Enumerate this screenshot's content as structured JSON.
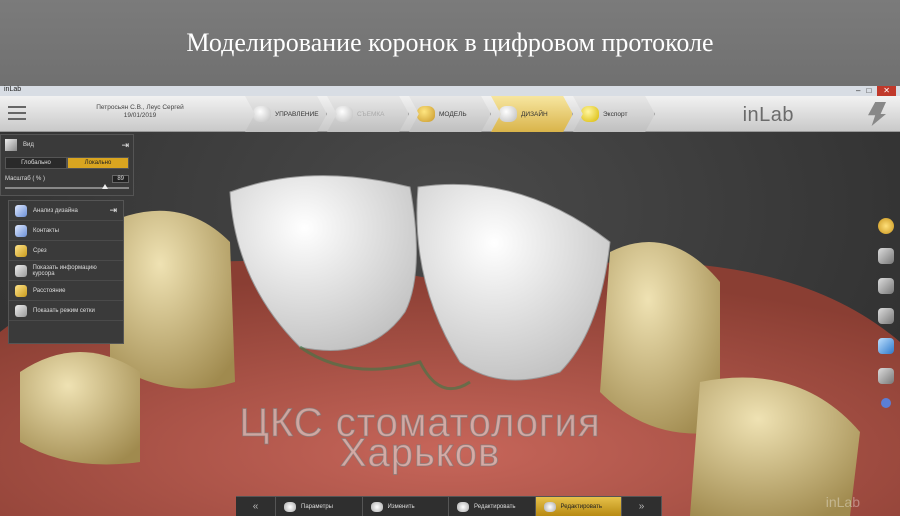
{
  "banner": {
    "title": "Моделирование коронок в цифровом протоколе"
  },
  "window": {
    "app_name": "inLab",
    "buttons": [
      "–",
      "□",
      "✕"
    ]
  },
  "toolbar": {
    "patient_name": "Петросьян С.В., Леус Сергей",
    "date": "19/01/2019",
    "steps": [
      {
        "label": "УПРАВЛЕНИЕ",
        "state": "done"
      },
      {
        "label": "СЪЕМКА",
        "state": "disabled"
      },
      {
        "label": "МОДЕЛЬ",
        "state": "done"
      },
      {
        "label": "ДИЗАЙН",
        "state": "active"
      },
      {
        "label": "Экспорт",
        "state": "next"
      }
    ],
    "brand": "inLab"
  },
  "view_panel": {
    "title": "Вид",
    "modes": [
      "Глобально",
      "Локально"
    ],
    "active_mode": "Локально",
    "scale_label": "Масштаб ( % )",
    "scale_value": "89"
  },
  "analysis_menu": {
    "title": "Анализ дизайна",
    "items": [
      "Контакты",
      "Срез",
      "Показать информацию курсора",
      "Расстояние",
      "Показать режим сетки"
    ]
  },
  "bottom_bar": {
    "items": [
      "Параметры",
      "Изменить",
      "Редактировать",
      "Редактировать"
    ],
    "active_index": 3
  },
  "watermark": {
    "line1": "ЦКС стоматология",
    "line2": "Харьков"
  },
  "corner_brand": "inLab",
  "colors": {
    "accent": "#d9a520",
    "panel": "#3a3a3a"
  }
}
